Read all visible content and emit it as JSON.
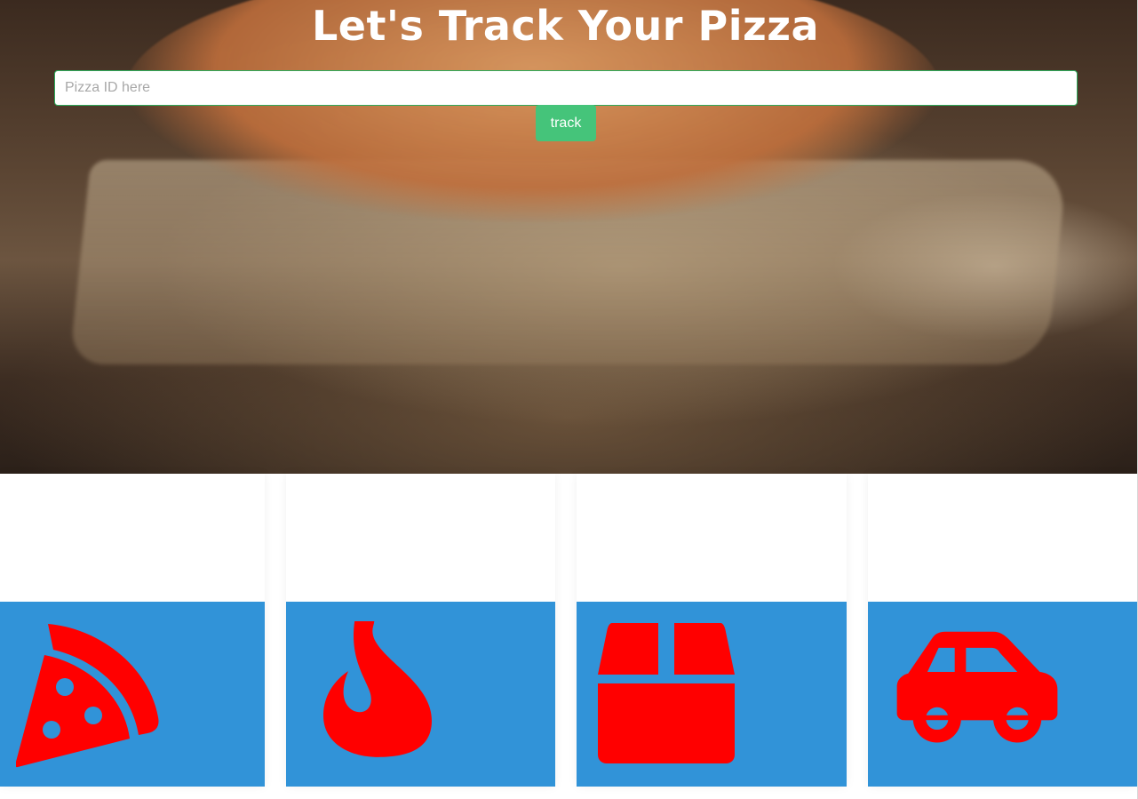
{
  "hero": {
    "title": "Let's Track Your Pizza",
    "background_image": "pizza-on-peel-photo"
  },
  "search": {
    "placeholder": "Pizza ID here",
    "value": ""
  },
  "track_button": {
    "label": "track"
  },
  "colors": {
    "accent_green": "#45c47a",
    "input_border": "#2eaa5a",
    "card_blue": "#3193d8",
    "icon_red": "#ff0000"
  },
  "status_cards": [
    {
      "icon": "pizza-slice-icon"
    },
    {
      "icon": "fire-icon"
    },
    {
      "icon": "box-icon"
    },
    {
      "icon": "car-icon"
    }
  ]
}
